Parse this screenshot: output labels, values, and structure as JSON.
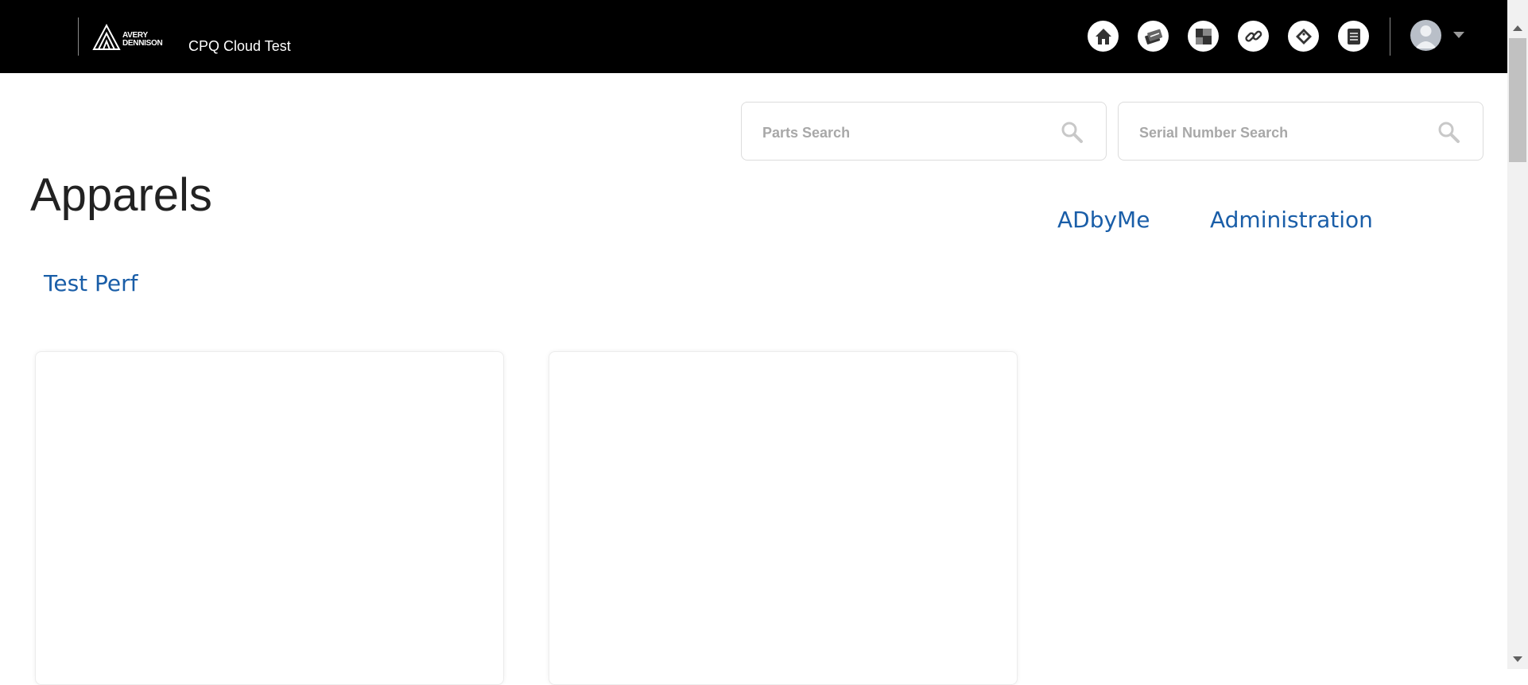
{
  "header": {
    "brand_line1": "AVERY",
    "brand_line2": "DENNISON",
    "app_title": "CPQ Cloud Test",
    "nav_icons": [
      "home-icon",
      "quotes-icon",
      "products-icon",
      "links-icon",
      "tag-icon",
      "document-icon"
    ],
    "avatar_icon": "user-avatar-icon",
    "menu_caret_icon": "chevron-down-icon"
  },
  "search": {
    "parts_placeholder": "Parts Search",
    "serial_placeholder": "Serial Number Search"
  },
  "main": {
    "title": "Apparels",
    "links": [
      "ADbyMe",
      "Administration"
    ],
    "sub_link": "Test Perf"
  },
  "colors": {
    "header_bg": "#000000",
    "link": "#1a5ea8",
    "title": "#222222"
  }
}
